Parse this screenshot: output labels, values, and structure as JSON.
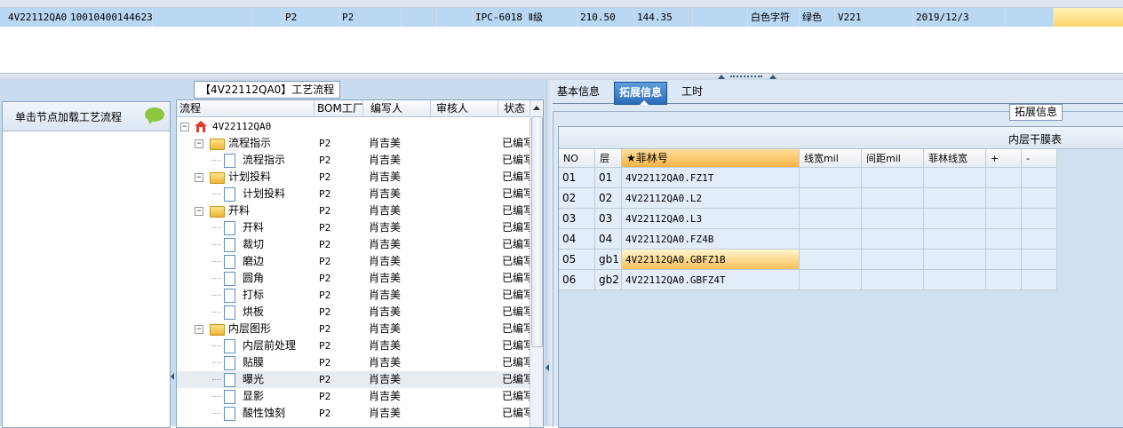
{
  "top_grid": {
    "row": [
      "4V22112QA0",
      "10010400144623",
      "P2",
      "P2",
      "IPC-6018 Ⅱ级",
      "210.50",
      "144.35",
      "白色字符",
      "绿色",
      "V221",
      "2019/12/3"
    ]
  },
  "left_panel": {
    "caption": "单击节点加载工艺流程",
    "bubble_icon": "chat-bubble-icon"
  },
  "tree": {
    "title": "【4V22112QA0】工艺流程",
    "headers": [
      "流程",
      "BOM工厂",
      "编写人",
      "审核人",
      "状态"
    ],
    "root": "4V22112QA0",
    "rows": [
      {
        "name": "流程指示",
        "type": "folder",
        "bom": "P2",
        "writer": "肖吉美",
        "status": "已编写"
      },
      {
        "name": "流程指示",
        "type": "doc",
        "bom": "P2",
        "writer": "肖吉美",
        "status": "已编写"
      },
      {
        "name": "计划投料",
        "type": "folder",
        "bom": "P2",
        "writer": "肖吉美",
        "status": "已编写"
      },
      {
        "name": "计划投料",
        "type": "doc",
        "bom": "P2",
        "writer": "肖吉美",
        "status": "已编写"
      },
      {
        "name": "开料",
        "type": "folder",
        "bom": "P2",
        "writer": "肖吉美",
        "status": "已编写"
      },
      {
        "name": "开料",
        "type": "doc",
        "bom": "P2",
        "writer": "肖吉美",
        "status": "已编写"
      },
      {
        "name": "裁切",
        "type": "doc",
        "bom": "P2",
        "writer": "肖吉美",
        "status": "已编写"
      },
      {
        "name": "磨边",
        "type": "doc",
        "bom": "P2",
        "writer": "肖吉美",
        "status": "已编写"
      },
      {
        "name": "圆角",
        "type": "doc",
        "bom": "P2",
        "writer": "肖吉美",
        "status": "已编写"
      },
      {
        "name": "打标",
        "type": "doc",
        "bom": "P2",
        "writer": "肖吉美",
        "status": "已编写"
      },
      {
        "name": "烘板",
        "type": "doc",
        "bom": "P2",
        "writer": "肖吉美",
        "status": "已编写"
      },
      {
        "name": "内层图形",
        "type": "folder",
        "bom": "P2",
        "writer": "肖吉美",
        "status": "已编写"
      },
      {
        "name": "内层前处理",
        "type": "doc",
        "bom": "P2",
        "writer": "肖吉美",
        "status": "已编写"
      },
      {
        "name": "贴膜",
        "type": "doc",
        "bom": "P2",
        "writer": "肖吉美",
        "status": "已编写"
      },
      {
        "name": "曝光",
        "type": "doc",
        "bom": "P2",
        "writer": "肖吉美",
        "status": "已编写"
      },
      {
        "name": "显影",
        "type": "doc",
        "bom": "P2",
        "writer": "肖吉美",
        "status": "已编写"
      },
      {
        "name": "酸性蚀刻",
        "type": "doc",
        "bom": "P2",
        "writer": "肖吉美",
        "status": "已编写"
      }
    ]
  },
  "tabs": [
    "基本信息",
    "拓展信息",
    "工时"
  ],
  "group_label": "拓展信息",
  "film_table": {
    "title": "内层干膜表",
    "headers": [
      "NO",
      "层",
      "★菲林号",
      "线宽mil",
      "间距mil",
      "菲林线宽",
      "+",
      "-"
    ],
    "rows": [
      [
        "01",
        "01",
        "4V22112QA0.FZ1T"
      ],
      [
        "02",
        "02",
        "4V22112QA0.L2"
      ],
      [
        "03",
        "03",
        "4V22112QA0.L3"
      ],
      [
        "04",
        "04",
        "4V22112QA0.FZ4B"
      ],
      [
        "05",
        "gb1",
        "4V22112QA0.GBFZ1B"
      ],
      [
        "06",
        "gb2",
        "4V22112QA0.GBFZ4T"
      ]
    ]
  }
}
